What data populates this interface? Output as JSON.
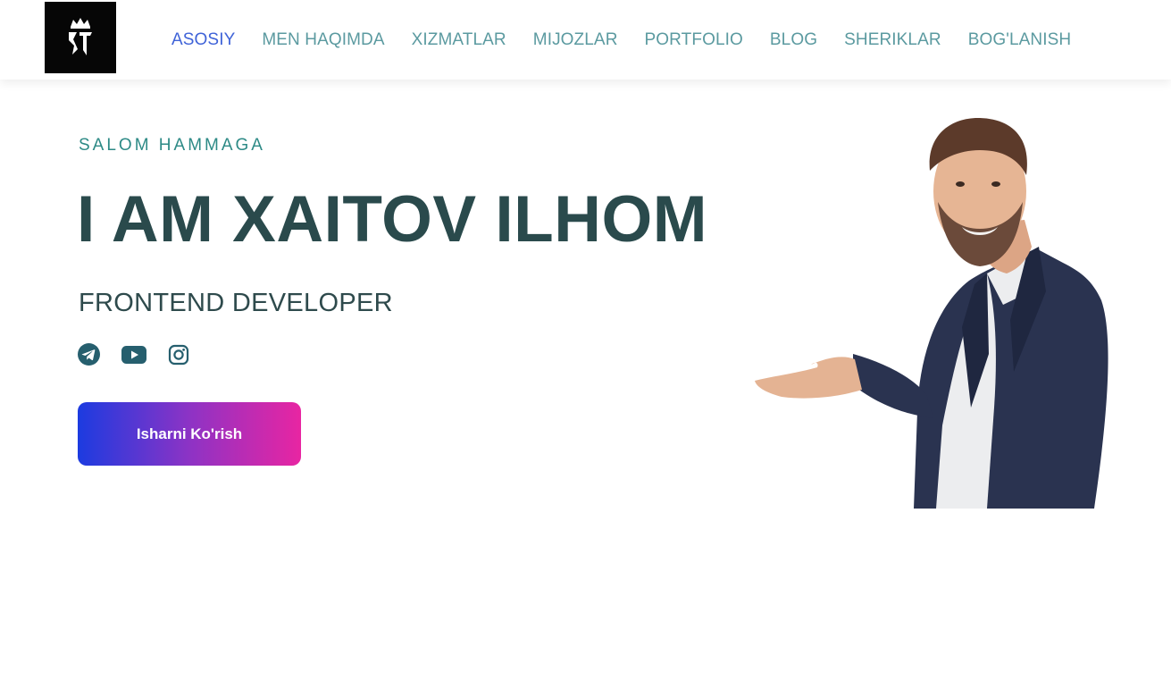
{
  "nav": {
    "logo_alt": "XI",
    "items": [
      {
        "label": "ASOSIY",
        "active": true
      },
      {
        "label": "MEN HAQIMDA",
        "active": false
      },
      {
        "label": "XIZMATLAR",
        "active": false
      },
      {
        "label": "MIJOZLAR",
        "active": false
      },
      {
        "label": "PORTFOLIO",
        "active": false
      },
      {
        "label": "BLOG",
        "active": false
      },
      {
        "label": "SHERIKLAR",
        "active": false
      },
      {
        "label": "BOG'LANISH",
        "active": false
      }
    ]
  },
  "hero": {
    "greeting": "SALOM HAMMAGA",
    "title": "I AM XAITOV ILHOM",
    "role": "FRONTEND DEVELOPER",
    "cta_label": "Isharni Ko'rish",
    "socials": [
      "telegram-icon",
      "youtube-icon",
      "instagram-icon"
    ]
  },
  "colors": {
    "nav_active": "#3f63d8",
    "nav_link": "#5b9aa0",
    "title": "#2a4a4c",
    "greeting": "#2d8a86",
    "icon": "#265f6e",
    "cta_gradient": [
      "#1c3be0",
      "#8d33c5",
      "#e825a2"
    ]
  }
}
